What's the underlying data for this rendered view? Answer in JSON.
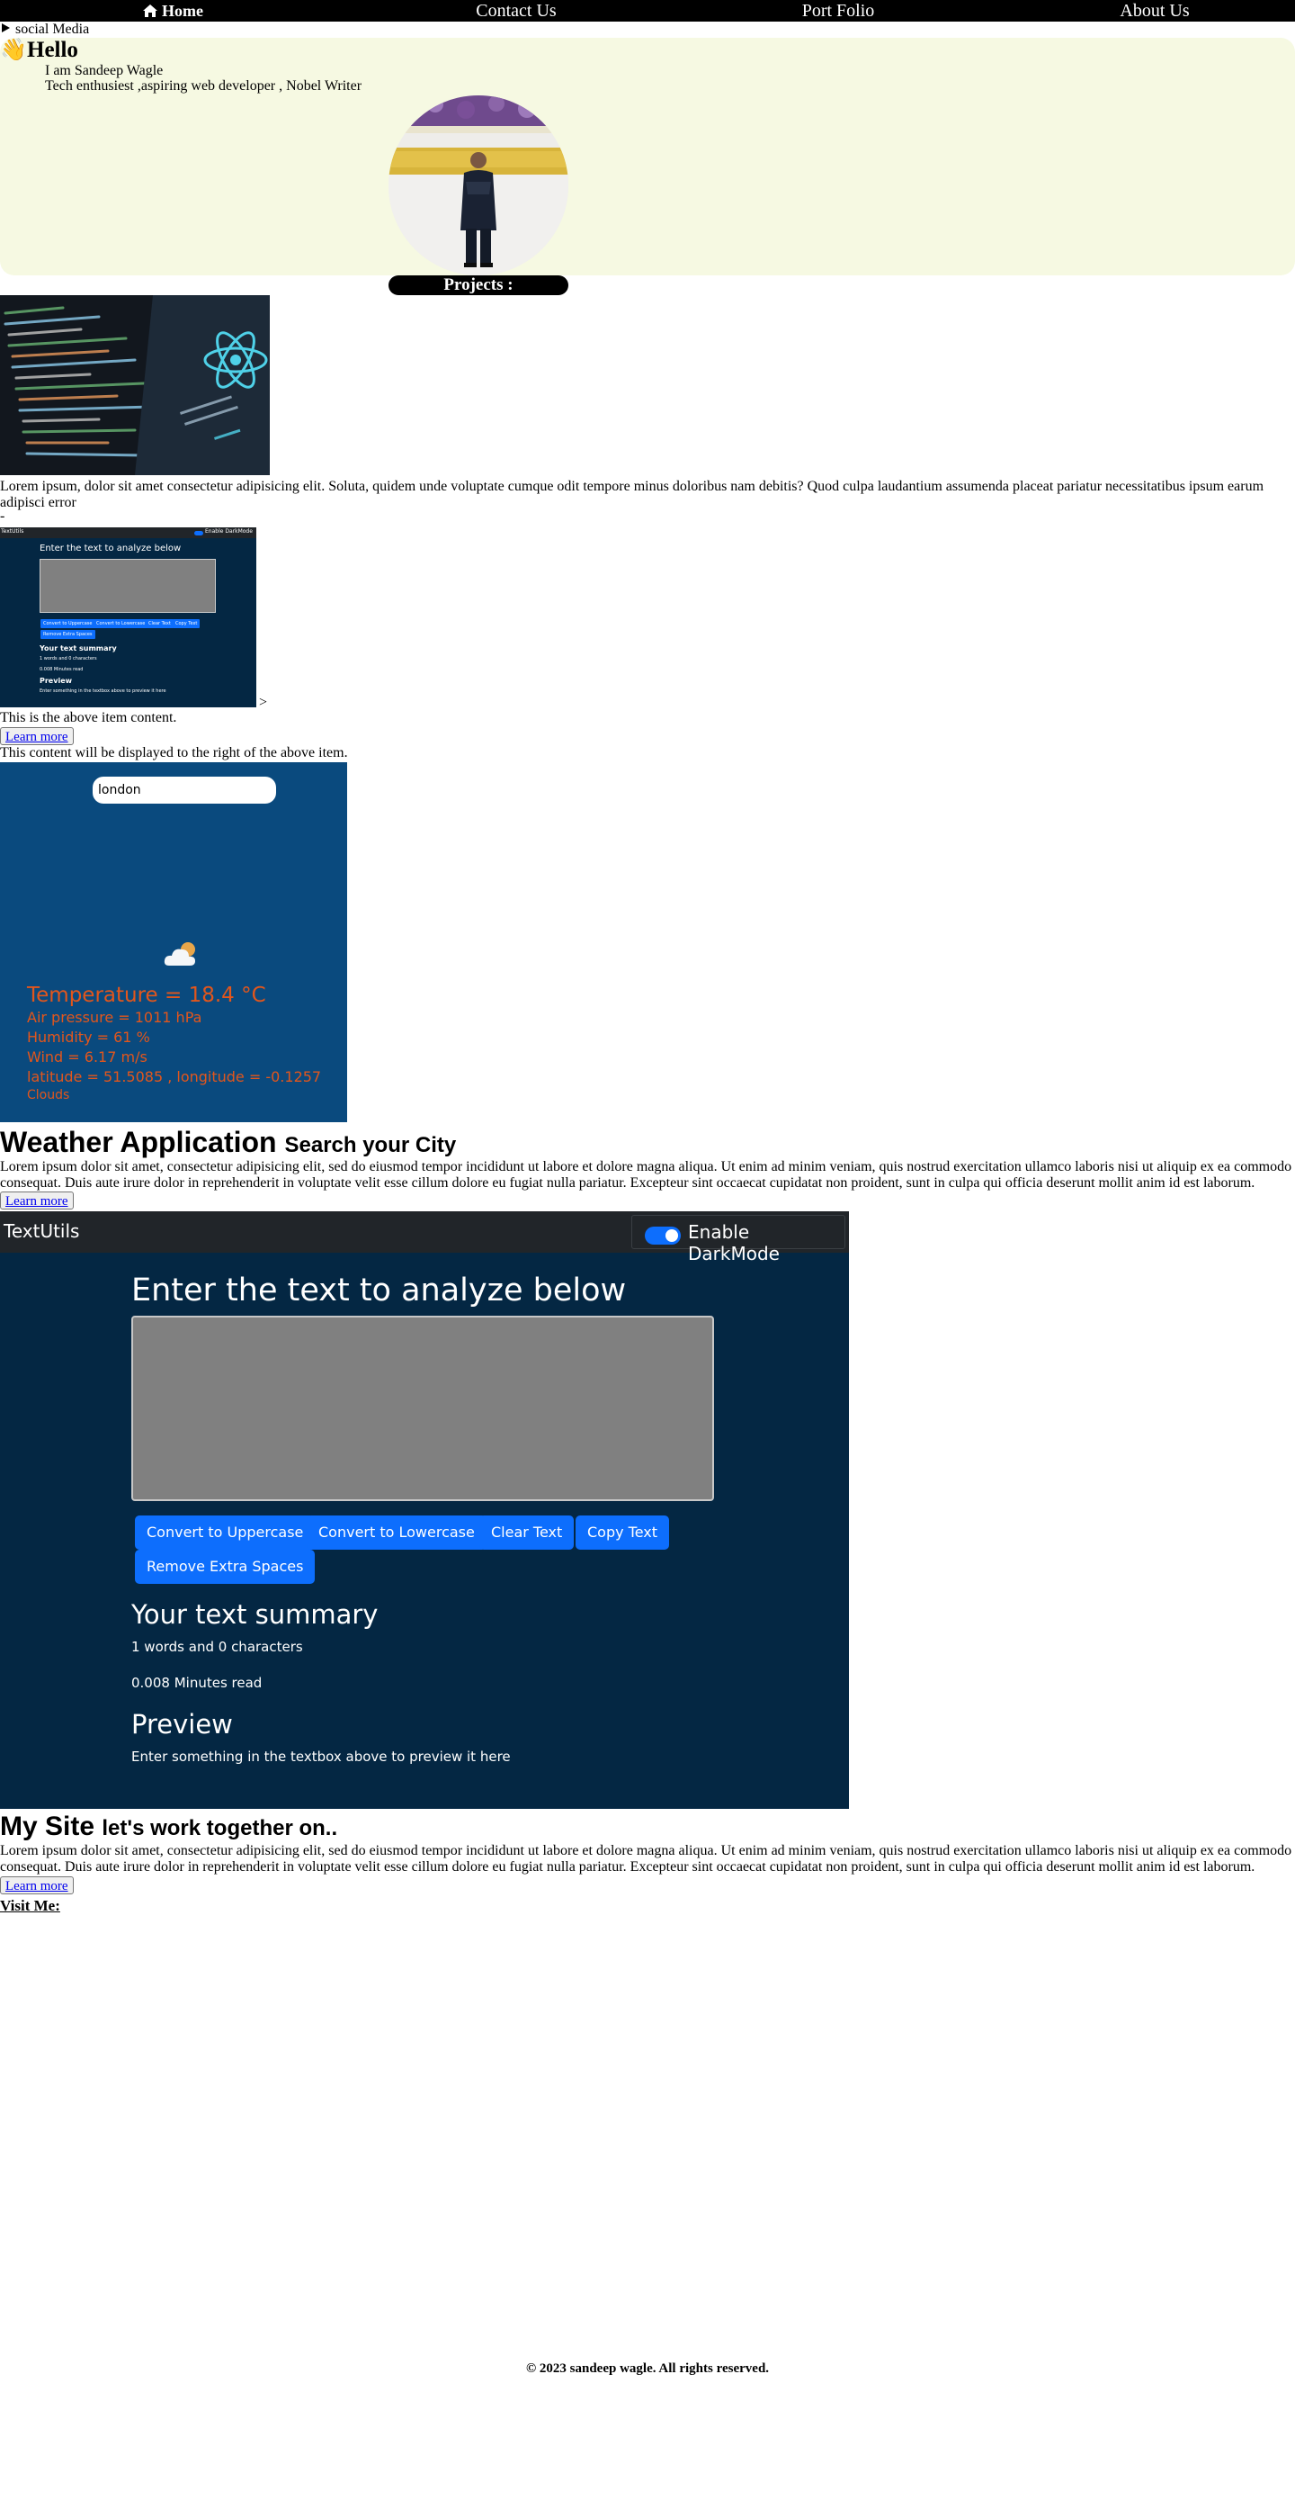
{
  "nav": {
    "items": [
      {
        "label": "Home"
      },
      {
        "label": "Contact Us"
      },
      {
        "label": "Port Folio"
      },
      {
        "label": "About Us"
      }
    ]
  },
  "social": {
    "label": "social Media"
  },
  "hero": {
    "greeting_emoji": "👋",
    "greeting": "Hello",
    "name_line": "I am Sandeep Wagle",
    "tagline": "Tech enthusiest ,aspiring web developer , Nobel Writer",
    "projects_label": "Projects :"
  },
  "project1": {
    "description": "Lorem ipsum, dolor sit amet consectetur adipisicing elit. Soluta, quidem unde voluptate cumque odit tempore minus doloribus nam debitis? Quod culpa laudantium assumenda placeat pariatur necessitatibus ipsum earum adipisci error",
    "dash": "-"
  },
  "project2": {
    "thumb_brand": "TextUtils",
    "thumb_mode": "Enable DarkMode",
    "thumb_heading": "Enter the text to analyze below",
    "thumb_buttons": [
      "Convert to Uppercase",
      "Convert to Lowercase",
      "Clear Text",
      "Copy Text",
      "Remove Extra Spaces"
    ],
    "thumb_summary": "Your text summary",
    "thumb_words": "1 words and 0 characters",
    "thumb_minutes": "0.008 Minutes read",
    "thumb_preview": "Preview",
    "thumb_preview_text": "Enter something in the textbox above to preview it here",
    "arrow": ">",
    "above_text": "This is the above item content.",
    "learn_more": "Learn more",
    "right_text": "This content will be displayed to the right of the above item."
  },
  "weather": {
    "search_value": "london",
    "temperature": "Temperature = 18.4 °C",
    "pressure": "Air pressure = 1011 hPa",
    "humidity": "Humidity = 61 %",
    "wind": "Wind = 6.17 m/s",
    "coords": "latitude = 51.5085 , longitude = -0.1257",
    "condition": "Clouds",
    "title": "Weather Application",
    "subtitle": "Search your City",
    "description": "Lorem ipsum dolor sit amet, consectetur adipisicing elit, sed do eiusmod tempor incididunt ut labore et dolore magna aliqua. Ut enim ad minim veniam, quis nostrud exercitation ullamco laboris nisi ut aliquip ex ea commodo consequat. Duis aute irure dolor in reprehenderit in voluptate velit esse cillum dolore eu fugiat nulla pariatur. Excepteur sint occaecat cupidatat non proident, sunt in culpa qui officia deserunt mollit anim id est laborum.",
    "learn_more": "Learn more",
    "text_color": "#e2561c",
    "bg_color": "#0a4a7e"
  },
  "textutils": {
    "brand": "TextUtils",
    "mode_label": "Enable DarkMode",
    "heading": "Enter the text to analyze below",
    "buttons": {
      "upper": "Convert to Uppercase",
      "lower": "Convert to Lowercase",
      "clear": "Clear Text",
      "copy": "Copy Text",
      "spaces": "Remove Extra Spaces"
    },
    "summary_heading": "Your text summary",
    "words": "1 words and 0 characters",
    "minutes": "0.008 Minutes read",
    "preview_heading": "Preview",
    "preview_text": "Enter something in the textbox above to preview it here"
  },
  "mysite": {
    "title": "My Site",
    "subtitle": "let's work together on..",
    "description": "Lorem ipsum dolor sit amet, consectetur adipisicing elit, sed do eiusmod tempor incididunt ut labore et dolore magna aliqua. Ut enim ad minim veniam, quis nostrud exercitation ullamco laboris nisi ut aliquip ex ea commodo consequat. Duis aute irure dolor in reprehenderit in voluptate velit esse cillum dolore eu fugiat nulla pariatur. Excepteur sint occaecat cupidatat non proident, sunt in culpa qui officia deserunt mollit anim id est laborum.",
    "learn_more": "Learn more",
    "visit": "Visit Me:"
  },
  "footer": {
    "text": "© 2023 sandeep wagle. All rights reserved."
  },
  "colors": {
    "nav_bg": "#000000",
    "hero_bg": "#f6f9e2",
    "textutils_bg": "#042743",
    "button_blue": "#0d6efd"
  }
}
